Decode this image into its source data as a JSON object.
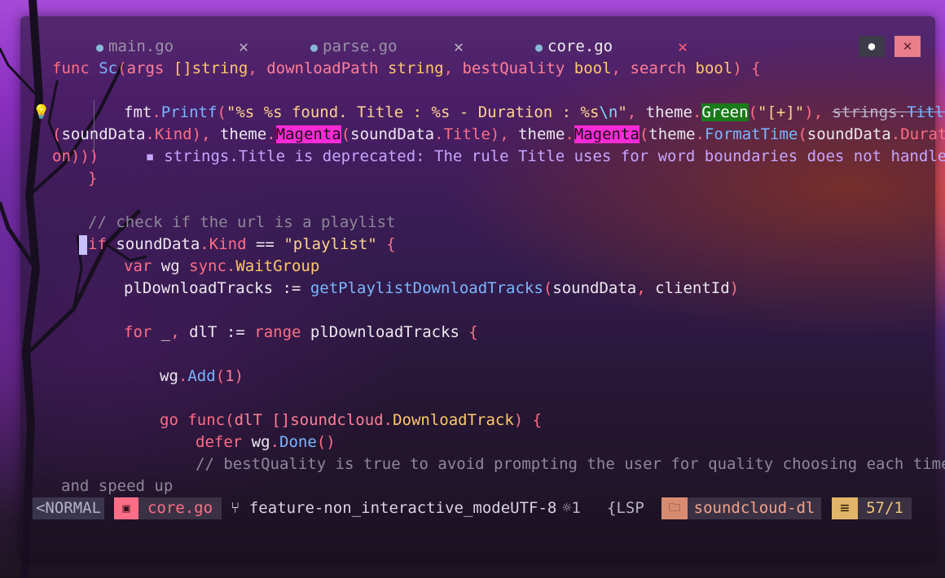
{
  "tabs": [
    {
      "label": "main.go",
      "close": "✕",
      "active": false
    },
    {
      "label": "parse.go",
      "close": "✕",
      "active": false
    },
    {
      "label": "core.go",
      "close": "✕",
      "active": true
    }
  ],
  "window_buttons": {
    "toggle": "●",
    "close": "✕"
  },
  "code": {
    "l1": {
      "kw": "func",
      "name": "Sc",
      "p1": "args",
      "t1": "[]string",
      "p2": "downloadPath",
      "t2": "string",
      "p3": "bestQuality",
      "t3": "bool",
      "p4": "search",
      "t4": "bool"
    },
    "l2": {
      "pkg": "fmt",
      "fn": "Printf",
      "fmt": "\"%s %s found. Title : %s - Duration : %s",
      "esc": "\\n",
      "fmtend": "\"",
      "theme": "theme",
      "green": "Green",
      "plus": "\"[+]\"",
      "strings": "strings",
      "title_fn": "Title"
    },
    "l3": {
      "sd": "soundData",
      "kind": "Kind",
      "theme": "theme",
      "magenta": "Magenta",
      "sd2": "soundData",
      "title": "Title",
      "theme2": "theme",
      "magenta2": "Magenta",
      "theme3": "theme",
      "formattime": "FormatTime",
      "sd3": "soundData",
      "durati": "Durati"
    },
    "l4": {
      "cont": "on",
      "closers": ")))",
      "diag": "▪ strings.Title is deprecated: The rule Title uses for word boundaries does not handle"
    },
    "l5": {
      "brace": "}"
    },
    "l6": {
      "comment": "// check if the url is a playlist"
    },
    "l7": {
      "kw": "if",
      "sd": "soundData",
      "kind": "Kind",
      "op": "==",
      "str": "\"playlist\""
    },
    "l8": {
      "kw": "var",
      "var": "wg",
      "pkg": "sync",
      "type": "WaitGroup"
    },
    "l9": {
      "var": "plDownloadTracks",
      "op": ":=",
      "fn": "getPlaylistDownloadTracks",
      "a1": "soundData",
      "a2": "clientId"
    },
    "l10": {
      "kw": "for",
      "blank": "_",
      "var": "dlT",
      "op": ":=",
      "range": "range",
      "tracks": "plDownloadTracks"
    },
    "l11": {
      "var": "wg",
      "fn": "Add",
      "num": "1"
    },
    "l12": {
      "kw": "go",
      "kw2": "func",
      "param": "dlT",
      "pkg": "[]soundcloud",
      "type": "DownloadTrack"
    },
    "l13": {
      "kw": "defer",
      "var": "wg",
      "fn": "Done"
    },
    "l14": {
      "comment": "// bestQuality is true to avoid prompting the user for quality choosing each time"
    },
    "l15": {
      "comment": "and speed up"
    }
  },
  "statusbar": {
    "mode": "<NORMAL",
    "file_icon": "▣",
    "file": "core.go",
    "branch": "feature-non_interactive_modeUTF-8",
    "branch_icon": "⑂",
    "hints": "☼1",
    "lsp": "{LSP",
    "project_icon": "🗀",
    "project": "soundcloud-dl",
    "pos_icon": "≡",
    "position": "57/1"
  },
  "colors": {
    "keyword": "#ff6e86",
    "function": "#7ab6ff",
    "type": "#ffc86b",
    "string": "#ffd48f",
    "comment": "#8d8899"
  }
}
